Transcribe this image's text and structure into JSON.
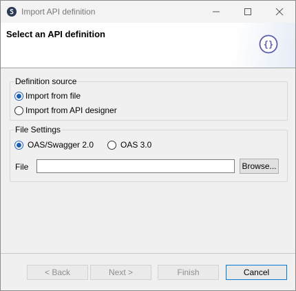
{
  "window": {
    "title": "Import API definition"
  },
  "banner": {
    "title": "Select an API definition",
    "icon": "json-braces-icon"
  },
  "definition_source": {
    "legend": "Definition source",
    "options": [
      {
        "label": "Import from file",
        "selected": true
      },
      {
        "label": "Import from API designer",
        "selected": false
      }
    ]
  },
  "file_settings": {
    "legend": "File Settings",
    "spec_options": [
      {
        "label": "OAS/Swagger 2.0",
        "selected": true
      },
      {
        "label": "OAS 3.0",
        "selected": false
      }
    ],
    "file_label": "File",
    "file_value": "",
    "browse_label": "Browse..."
  },
  "footer": {
    "back_label": "< Back",
    "next_label": "Next >",
    "finish_label": "Finish",
    "cancel_label": "Cancel"
  },
  "colors": {
    "accent": "#1a5fb4",
    "window_bg": "#f0f0f0"
  }
}
